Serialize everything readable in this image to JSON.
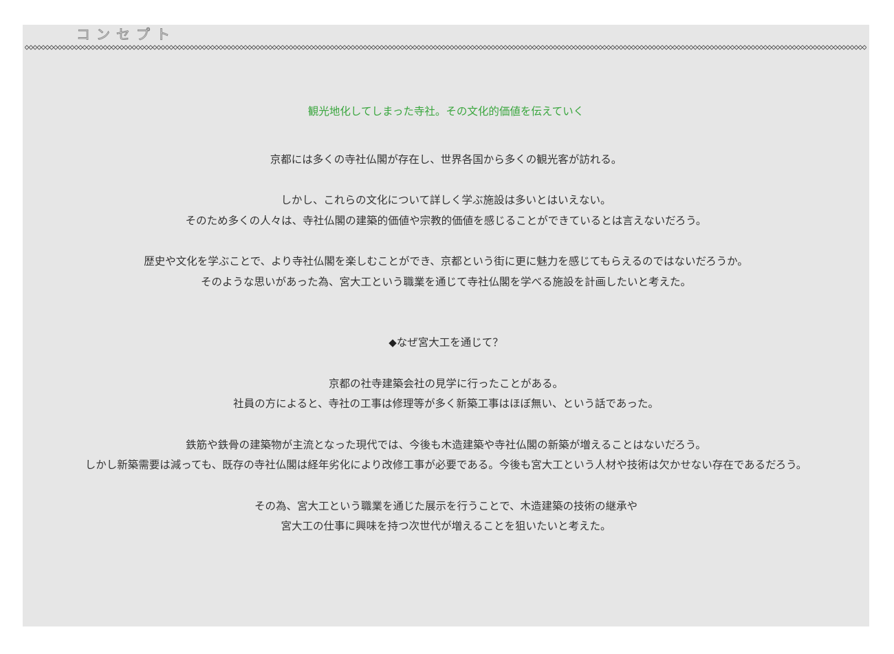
{
  "section": {
    "heading": "コンセプト"
  },
  "concept": {
    "tagline": "観光地化してしまった寺社。その文化的価値を伝えていく",
    "para1": "京都には多くの寺社仏閣が存在し、世界各国から多くの観光客が訪れる。",
    "para2_line1": "しかし、これらの文化について詳しく学ぶ施設は多いとはいえない。",
    "para2_line2": "そのため多くの人々は、寺社仏閣の建築的価値や宗教的価値を感じることができているとは言えないだろう。",
    "para3_line1": "歴史や文化を学ぶことで、より寺社仏閣を楽しむことができ、京都という街に更に魅力を感じてもらえるのではないだろうか。",
    "para3_line2": "そのような思いがあった為、宮大工という職業を通じて寺社仏閣を学べる施設を計画したいと考えた。"
  },
  "why": {
    "bullet": "◆",
    "heading": "なぜ宮大工を通じて？",
    "para1_line1": "京都の社寺建築会社の見学に行ったことがある。",
    "para1_line2": "社員の方によると、寺社の工事は修理等が多く新築工事はほぼ無い、という話であった。",
    "para2_line1": "鉄筋や鉄骨の建築物が主流となった現代では、今後も木造建築や寺社仏閣の新築が増えることはないだろう。",
    "para2_line2": "しかし新築需要は減っても、既存の寺社仏閣は経年劣化により改修工事が必要である。今後も宮大工という人材や技術は欠かせない存在であるだろう。",
    "para3_line1": "その為、宮大工という職業を通じた展示を行うことで、木造建築の技術の継承や",
    "para3_line2": "宮大工の仕事に興味を持つ次世代が増えることを狙いたいと考えた。"
  }
}
